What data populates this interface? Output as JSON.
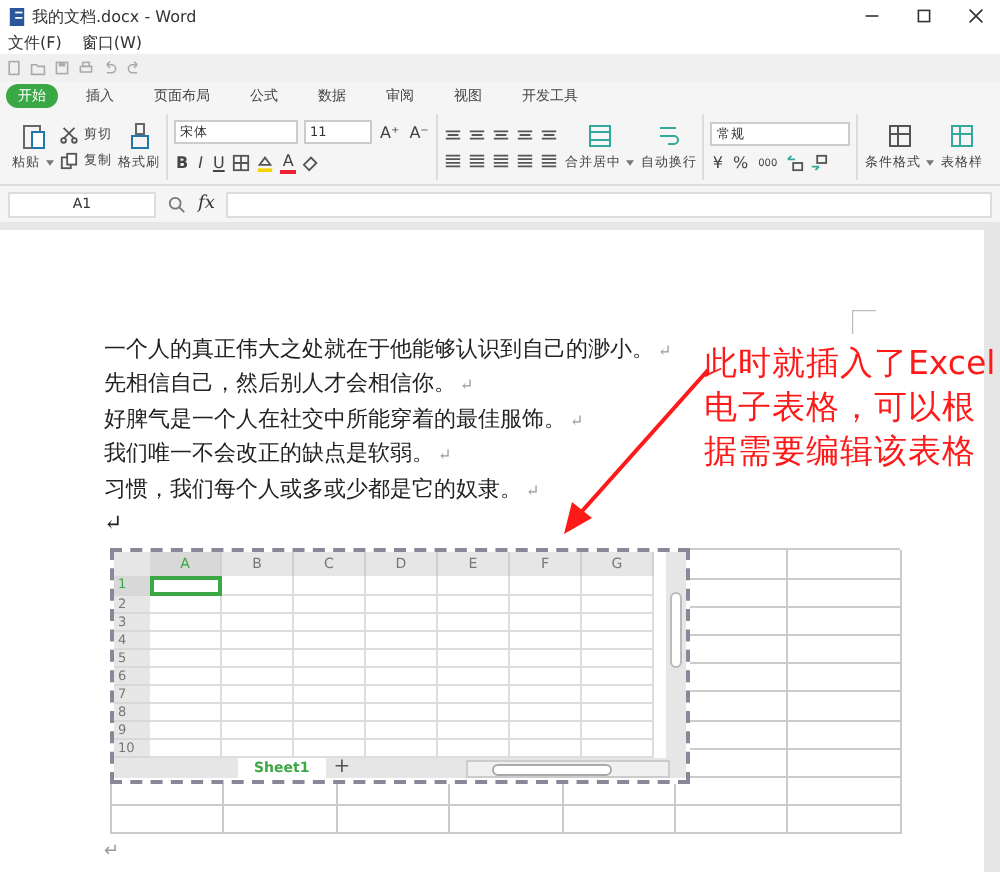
{
  "window": {
    "title": "我的文档.docx - Word"
  },
  "menu": [
    "文件(F)",
    "窗口(W)"
  ],
  "tabs": [
    {
      "label": "开始",
      "selected": true
    },
    {
      "label": "插入",
      "selected": false
    },
    {
      "label": "页面布局",
      "selected": false
    },
    {
      "label": "公式",
      "selected": false
    },
    {
      "label": "数据",
      "selected": false
    },
    {
      "label": "审阅",
      "selected": false
    },
    {
      "label": "视图",
      "selected": false
    },
    {
      "label": "开发工具",
      "selected": false
    }
  ],
  "ribbon": {
    "paste": "粘贴",
    "cut": "剪切",
    "copy": "复制",
    "format_painter": "格式刷",
    "font_name": "宋体",
    "font_size": "11",
    "grow": "A⁺",
    "shrink": "A⁻",
    "bold": "B",
    "italic": "I",
    "underline": "U",
    "font_color": "A",
    "merge": "合并居中",
    "wrap": "自动换行",
    "number_format": "常规",
    "currency": "¥",
    "percent": "%",
    "thousands": "000",
    "conditional_format": "条件格式",
    "table_style": "表格样"
  },
  "formula_bar": {
    "cell_ref": "A1",
    "fx": "fx"
  },
  "paragraphs": [
    {
      "text": "一个人的真正伟大之处就在于他能够认识到自己的渺小。",
      "mark": "↵"
    },
    {
      "text": "先相信自己，然后别人才会相信你。",
      "mark": "↵"
    },
    {
      "text": "好脾气是一个人在社交中所能穿着的最佳服饰。",
      "mark": "↵"
    },
    {
      "text": "我们唯一不会改正的缺点是软弱。",
      "mark": "↵"
    },
    {
      "text": "习惯，我们每个人或多或少都是它的奴隶。",
      "mark": "↵"
    }
  ],
  "blank_line_mark": "↵",
  "annotation": [
    "此时就插入了Excel",
    "电子表格，可以根",
    "据需要编辑该表格"
  ],
  "spreadsheet": {
    "columns": [
      {
        "label": "A",
        "selected": true
      },
      {
        "label": "B",
        "selected": false
      },
      {
        "label": "C",
        "selected": false
      },
      {
        "label": "D",
        "selected": false
      },
      {
        "label": "E",
        "selected": false
      },
      {
        "label": "F",
        "selected": false
      },
      {
        "label": "G",
        "selected": false
      }
    ],
    "rows": [
      {
        "label": "1",
        "selected": true
      },
      {
        "label": "2",
        "selected": false
      },
      {
        "label": "3",
        "selected": false
      },
      {
        "label": "4",
        "selected": false
      },
      {
        "label": "5",
        "selected": false
      },
      {
        "label": "6",
        "selected": false
      },
      {
        "label": "7",
        "selected": false
      },
      {
        "label": "8",
        "selected": false
      },
      {
        "label": "9",
        "selected": false
      },
      {
        "label": "10",
        "selected": false
      }
    ],
    "sheet_tab": "Sheet1",
    "add_sheet": "+"
  },
  "end_mark": "↵"
}
